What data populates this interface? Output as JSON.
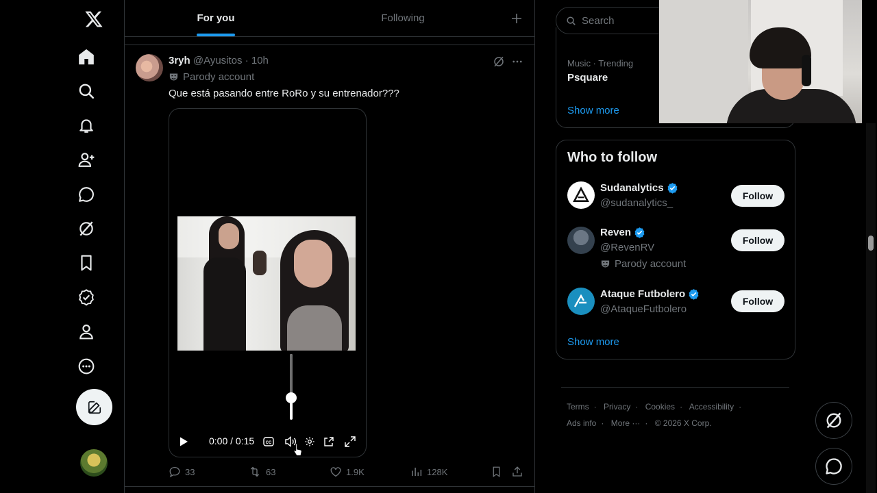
{
  "colors": {
    "accent": "#1d9bf0",
    "muted": "#71767b",
    "text": "#e7e9ea",
    "border": "#2f3336"
  },
  "nav": {
    "icons": [
      "x-logo-icon",
      "home-icon",
      "explore-icon",
      "notifications-icon",
      "follow-icon",
      "chat-icon",
      "grok-icon",
      "bookmarks-icon",
      "verified-icon",
      "profile-icon",
      "more-icon"
    ]
  },
  "tabs": {
    "for_you": "For you",
    "following": "Following"
  },
  "post": {
    "name": "3ryh",
    "handle": "@Ayusitos",
    "time": "· 10h",
    "badge": "Parody account",
    "text": "Que está pasando entre RoRo y su entrenador???",
    "video": {
      "time": "0:00 / 0:15",
      "volume_fraction": 0.33
    },
    "stats": {
      "replies": "33",
      "reposts": "63",
      "likes": "1.9K",
      "views": "128K"
    }
  },
  "sidebar": {
    "search_placeholder": "Search",
    "trend": {
      "meta": "Music · Trending",
      "name": "Psquare"
    },
    "show_more": "Show more",
    "who_to_follow": {
      "title": "Who to follow",
      "users": [
        {
          "name": "Sudanalytics",
          "handle": "@sudanalytics_",
          "follow": "Follow"
        },
        {
          "name": "Reven",
          "handle": "@RevenRV",
          "badge": "Parody account",
          "follow": "Follow"
        },
        {
          "name": "Ataque Futbolero",
          "handle": "@AtaqueFutbolero",
          "follow": "Follow"
        }
      ],
      "show_more": "Show more"
    },
    "footer": {
      "row1": [
        "Terms",
        "Privacy",
        "Cookies",
        "Accessibility"
      ],
      "row2": [
        "Ads info",
        "More ···",
        "© 2026 X Corp."
      ]
    }
  }
}
